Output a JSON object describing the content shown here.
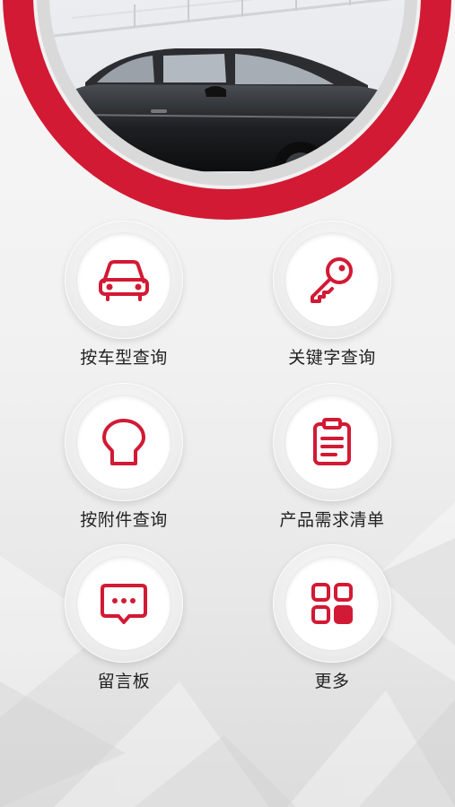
{
  "accent_color": "#d21a34",
  "hero": {
    "image": "black-sedan-photo",
    "ring": "red-ring"
  },
  "menu": {
    "items": [
      {
        "label": "按车型查询",
        "icon": "car-icon"
      },
      {
        "label": "关键字查询",
        "icon": "key-icon"
      },
      {
        "label": "按附件查询",
        "icon": "part-icon"
      },
      {
        "label": "产品需求清单",
        "icon": "clipboard-icon"
      },
      {
        "label": "留言板",
        "icon": "message-icon"
      },
      {
        "label": "更多",
        "icon": "grid-icon"
      }
    ]
  }
}
